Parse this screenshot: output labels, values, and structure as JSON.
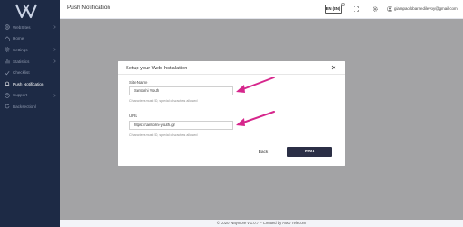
{
  "header": {
    "page_title": "Push Notification",
    "language": "EN (EN)",
    "user_email": "giampaolobarnedilevoy@gmail.com"
  },
  "sidebar": {
    "items": [
      {
        "label": "WebSites",
        "icon": "globe-icon",
        "has_children": true
      },
      {
        "label": "Home",
        "icon": "home-icon",
        "has_children": false
      },
      {
        "label": "Settings",
        "icon": "gear-icon",
        "has_children": true
      },
      {
        "label": "Statistics",
        "icon": "chart-icon",
        "has_children": true
      },
      {
        "label": "Checklist",
        "icon": "check-icon",
        "has_children": false
      },
      {
        "label": "Push Notification",
        "icon": "bell-icon",
        "has_children": false,
        "active": true
      },
      {
        "label": "Support",
        "icon": "help-icon",
        "has_children": true
      },
      {
        "label": "Backsectionl",
        "icon": "refresh-icon",
        "has_children": false
      }
    ]
  },
  "modal": {
    "title": "Setup your Web Installation",
    "site_name": {
      "label": "Site Name",
      "value": "Santorini Youth",
      "hint": "Characters must 50, special characters allowed"
    },
    "url": {
      "label": "URL",
      "value": "https://santorini-youth.gr",
      "hint": "Characters must 50, special characters allowed"
    },
    "back_label": "Back",
    "next_label": "Next"
  },
  "footer": {
    "text": "© 2020 Waymore v 1.0.7 – Created by AMD Telecom"
  },
  "colors": {
    "sidebar_bg": "#1d2a45",
    "primary_button": "#2b2f46",
    "annotation_arrow": "#d6268c"
  }
}
